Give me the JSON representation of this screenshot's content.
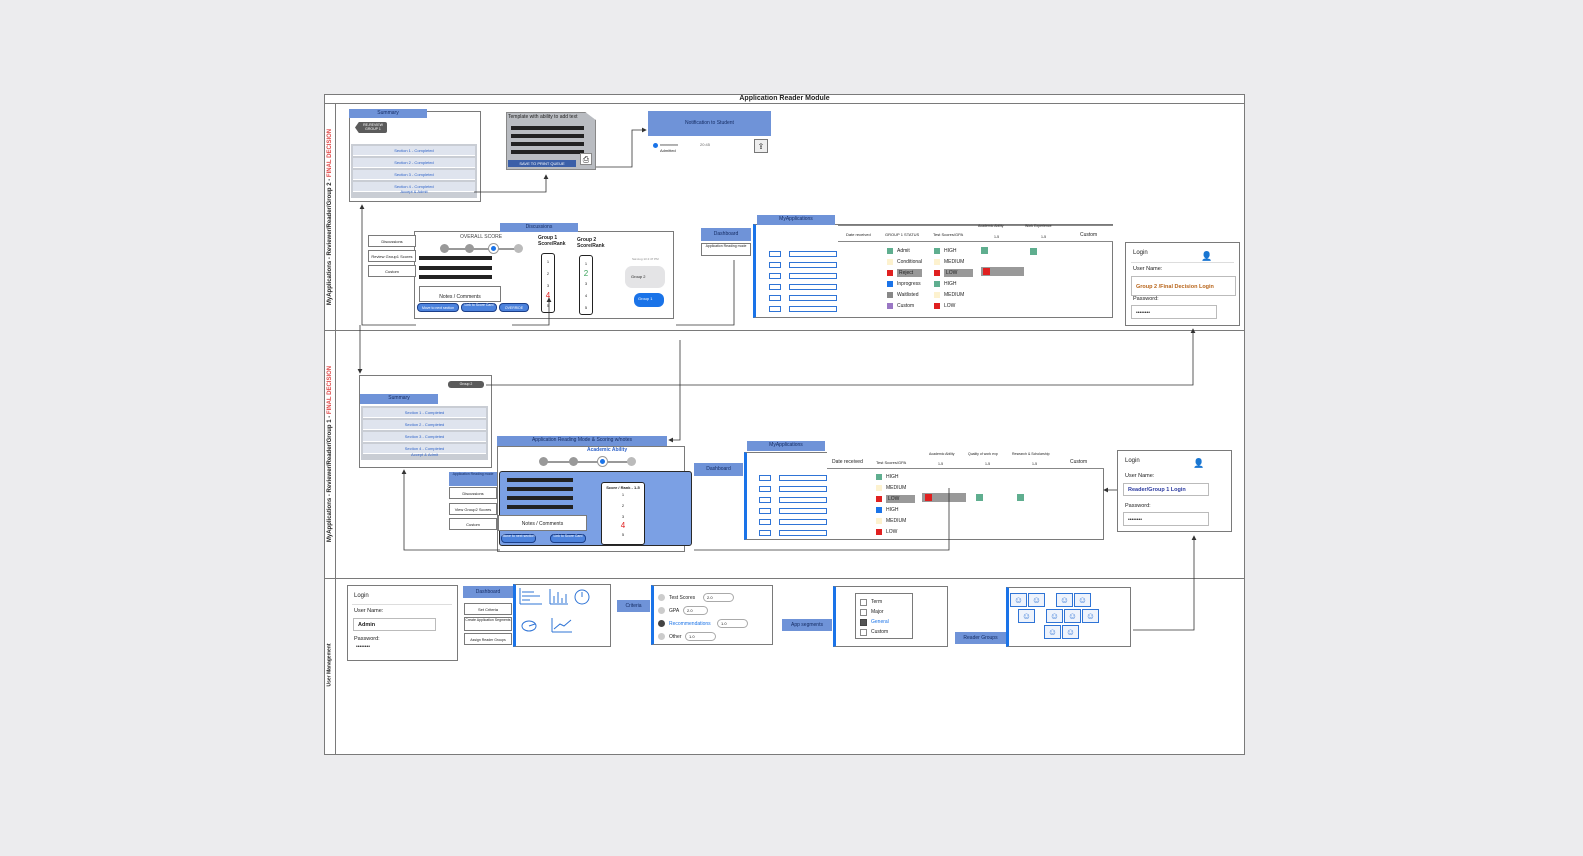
{
  "title": "Application Reader Module",
  "lanes": {
    "lane1_prefix": "MyApplications - Reviewer/Reader/Group 2 - ",
    "lane1_suffix": "FINAL DECISION",
    "lane2_prefix": "MyApplications - Reviewer/Reader/Group 1 - ",
    "lane2_suffix": "FINAL DECISION",
    "lane3": "User Management"
  },
  "lane1": {
    "summary": {
      "header": "Summary",
      "tag": "RE-REVIEW GROUP 1",
      "sections": [
        "Section 1 - Completed",
        "Section 2 - Completed",
        "Section 3 - Completed",
        "Section 4 - Completed"
      ],
      "action": "Accept & Admit"
    },
    "template": {
      "title": "Template with ability to add text",
      "button": "SAVE TO PRINT QUEUE"
    },
    "notification": {
      "header": "Notification to Student",
      "row_label": "xxxxxxxxx",
      "row_sub": "Admitted",
      "time": "20:45"
    },
    "discussions": {
      "header": "Discussions",
      "side_items": [
        "Discussions",
        "Review Group1 Scores",
        "Custom"
      ],
      "overall": "OVERALL SCORE",
      "notes": "Notes / Comments",
      "buttons": [
        "Move to next section",
        "Link to Score Card",
        "OVERRIDE"
      ],
      "g1_title": "Group 1 Score/Rank",
      "g2_title": "Group 2 Score/Rank",
      "g1_nums": [
        "1",
        "2",
        "3",
        "4",
        "5"
      ],
      "g2_nums": [
        "1",
        "2",
        "3",
        "4",
        "5"
      ],
      "chat_time": "Sat Aug 13 2:47 PM",
      "chat_in": "Group 2",
      "chat_out": "Group 1"
    },
    "dashboard": {
      "tab": "Dashboard",
      "reading": "Application Reading mode"
    },
    "myapps": {
      "header": "MyApplications",
      "cols": [
        "Date received",
        "GROUP 1 STATUS",
        "Test Scores/GPA",
        "Academic Ability",
        "Work Experience",
        "Custom"
      ],
      "ranges": [
        "1-5",
        "1-5"
      ],
      "status": [
        "Admit",
        "Conditional",
        "Reject",
        "Inprogress",
        "Waitlisted",
        "Custom"
      ],
      "scores": [
        "HIGH",
        "MEDIUM",
        "LOW",
        "HIGH",
        "MEDIUM",
        "LOW"
      ]
    },
    "login": {
      "title": "Login",
      "user_label": "User Name:",
      "user_value": "Group 2 /Final Decision Login",
      "pass_label": "Password:",
      "pass_value": "••••••••"
    }
  },
  "lane2": {
    "summary": {
      "header": "Summary",
      "tag": "Group 2",
      "sections": [
        "Section 1 - Completed",
        "Section 2 - Completed",
        "Section 3 - Completed",
        "Section 4 - Completed"
      ],
      "action": "Accept & Admit"
    },
    "reading": {
      "header": "Application Reading Mode & Scoring w/notes",
      "ability": "Academic Ability",
      "side_items": [
        "Application Reading mode",
        "Discussions",
        "View Group2 Scores",
        "Custom"
      ],
      "notes": "Notes / Comments",
      "buttons": [
        "Move to next section",
        "Link to Score Card"
      ],
      "score_title": "Score / Rank - 1-5",
      "score_nums": [
        "1",
        "2",
        "3",
        "4",
        "5"
      ]
    },
    "dashboard": "Dashboard",
    "myapps": {
      "header": "MyApplications",
      "cols": [
        "Date received",
        "Test Scores/GPA",
        "Academic Ability",
        "Quality of work exp",
        "Research & Scholarship",
        "Custom"
      ],
      "ranges": [
        "1-5",
        "1-5",
        "1-5"
      ],
      "scores": [
        "HIGH",
        "MEDIUM",
        "LOW",
        "HIGH",
        "MEDIUM",
        "LOW"
      ]
    },
    "login": {
      "title": "Login",
      "user_label": "User Name:",
      "user_value": "Reader/Group 1 Login",
      "pass_label": "Password:",
      "pass_value": "••••••••"
    }
  },
  "lane3": {
    "login": {
      "title": "Login",
      "user_label": "User Name:",
      "user_value": "Admin",
      "pass_label": "Password:",
      "pass_value": "••••••••"
    },
    "menu": {
      "items": [
        "Dashboard",
        "Set Criteria",
        "Create Application Segments",
        "Assign Reader Groups"
      ]
    },
    "criteria": {
      "label": "Criteria",
      "items": [
        "Test Scores",
        "GPA",
        "Recommendations",
        "Other"
      ],
      "values": [
        "2.0",
        "2.0",
        "1.0",
        "1.0"
      ]
    },
    "segments": {
      "label": "App segments",
      "items": [
        "Term",
        "Major",
        "General",
        "Custom"
      ]
    },
    "groups": {
      "label": "Reader Groups"
    }
  },
  "colors": {
    "status": [
      "#5fae8f",
      "#fdf2cf",
      "#e02020",
      "#1a73e8",
      "#888888",
      "#9a77c4"
    ],
    "accent": "#6f93d8",
    "final": "#e04848"
  }
}
